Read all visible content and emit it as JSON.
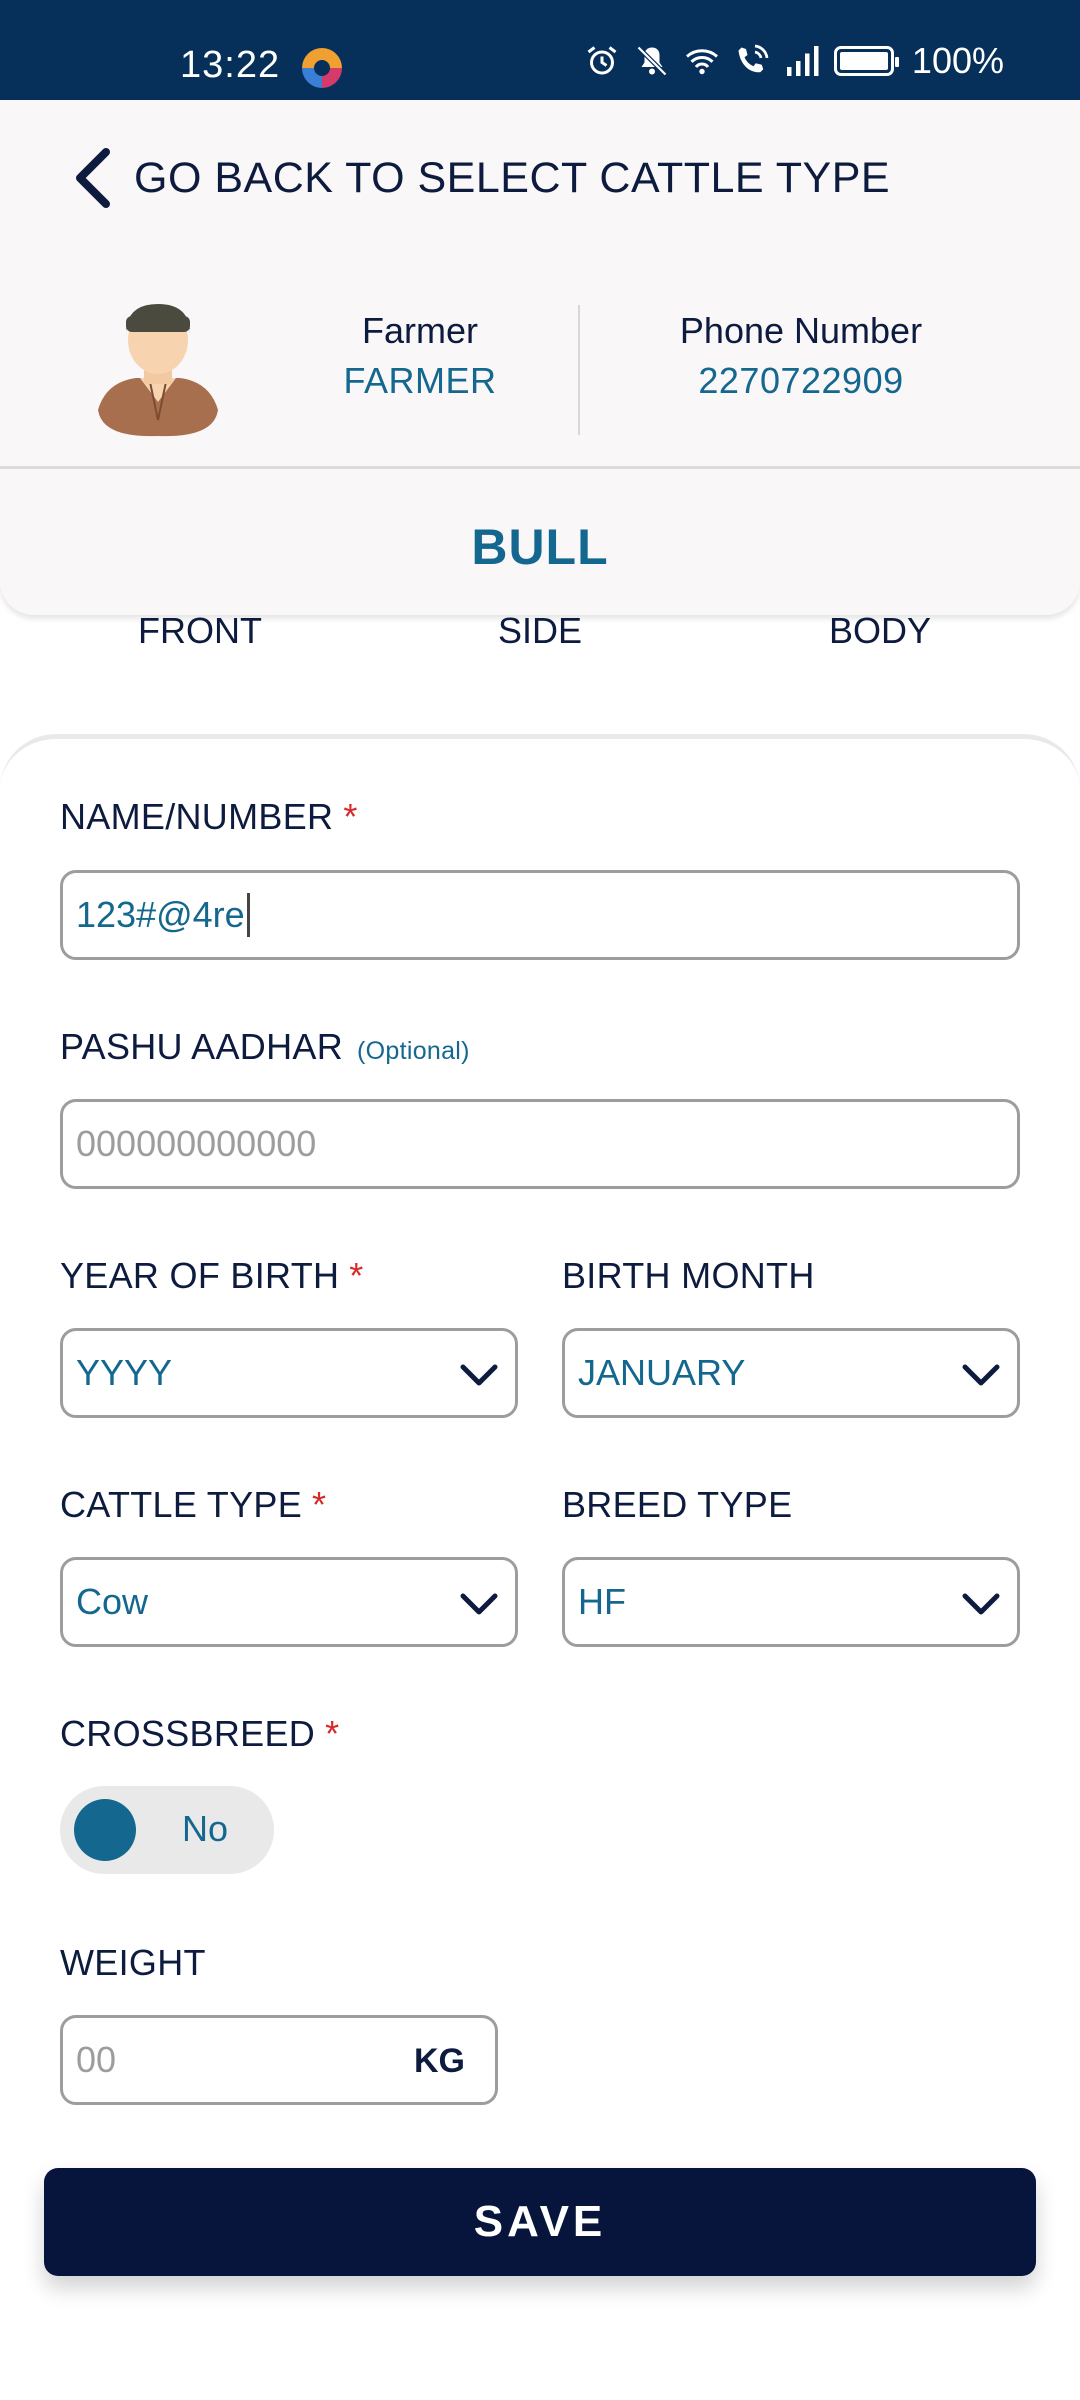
{
  "status_bar": {
    "time": "13:22",
    "battery_percent": "100%",
    "icons": [
      "app-icon",
      "alarm-icon",
      "mute-icon",
      "wifi-icon",
      "wifi-call-icon",
      "signal-icon",
      "battery-icon"
    ]
  },
  "header": {
    "back_label": "GO BACK TO SELECT CATTLE TYPE",
    "farmer_label": "Farmer",
    "farmer_value": "FARMER",
    "phone_label": "Phone Number",
    "phone_value": "2270722909",
    "cattle_title": "BULL"
  },
  "tabs": [
    "FRONT",
    "SIDE",
    "BODY"
  ],
  "form": {
    "name_label": "NAME/NUMBER",
    "name_value": "123#@4re",
    "pashu_label": "PASHU AADHAR",
    "pashu_optional": "(Optional)",
    "pashu_placeholder": "000000000000",
    "year_label": "YEAR OF BIRTH",
    "year_value": "YYYY",
    "month_label": "BIRTH MONTH",
    "month_value": "JANUARY",
    "cattle_type_label": "CATTLE TYPE",
    "cattle_type_value": "Cow",
    "breed_label": "BREED TYPE",
    "breed_value": "HF",
    "crossbreed_label": "CROSSBREED",
    "crossbreed_value": "No",
    "weight_label": "WEIGHT",
    "weight_placeholder": "00",
    "weight_unit": "KG",
    "required_marker": "*"
  },
  "save_label": "SAVE",
  "colors": {
    "status_bar": "#062f5a",
    "accent": "#14678f",
    "text_dark": "#0d1b3e",
    "required": "#d62a2a",
    "save_button": "#07153d"
  }
}
